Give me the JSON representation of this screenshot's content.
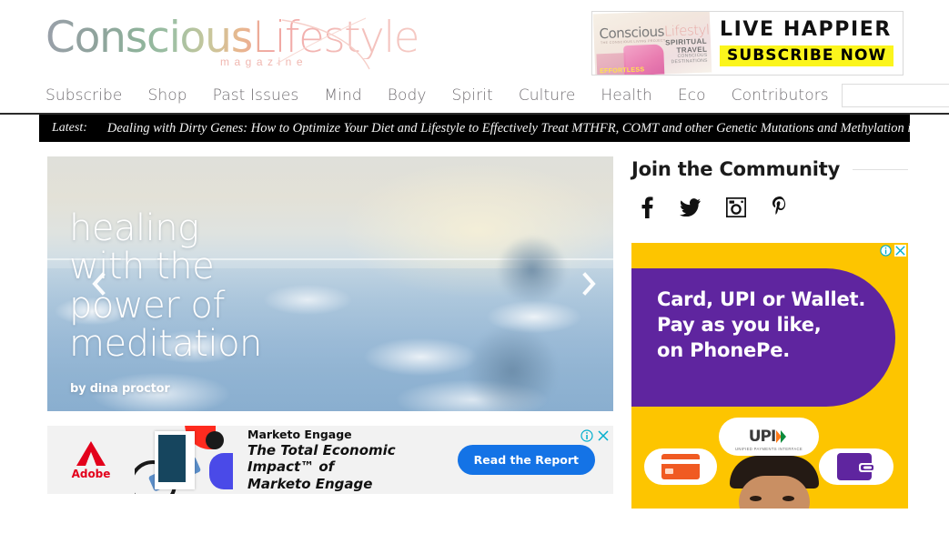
{
  "site": {
    "logo_main_1": "Conscious",
    "logo_main_2": "Lifestyle",
    "logo_sub": "magazine"
  },
  "banner_ad": {
    "cover_logo_1": "Conscious",
    "cover_logo_2": "Lifestyle",
    "cover_tagline": "THE CONSCIOUS LIVING PROJECT",
    "cover_effortless": "EFFORTLESS",
    "cover_spiritual_1": "SPIRITUAL",
    "cover_spiritual_2": "TRAVEL",
    "cover_spiritual_3": "CONSCIOUS",
    "cover_spiritual_4": "DESTINATIONS",
    "headline": "LIVE HAPPIER",
    "cta": "SUBSCRIBE NOW"
  },
  "nav": {
    "items": [
      {
        "label": "Subscribe"
      },
      {
        "label": "Shop"
      },
      {
        "label": "Past Issues"
      },
      {
        "label": "Mind"
      },
      {
        "label": "Body"
      },
      {
        "label": "Spirit"
      },
      {
        "label": "Culture"
      },
      {
        "label": "Health"
      },
      {
        "label": "Eco"
      },
      {
        "label": "Contributors"
      }
    ],
    "search": {
      "value": "",
      "placeholder": "",
      "icon": "search-icon"
    }
  },
  "ticker": {
    "label": "Latest:",
    "text": "Dealing with Dirty Genes: How to Optimize Your Diet and Lifestyle to Effectively Treat MTHFR, COMT and other Genetic Mutations and Methylation i"
  },
  "hero": {
    "title_line_1": "healing",
    "title_line_2": "with the",
    "title_line_3": "power of",
    "title_line_4": "meditation",
    "byline": "by dina proctor",
    "prev_icon": "chevron-left-icon",
    "next_icon": "chevron-right-icon"
  },
  "adobe_ad": {
    "brand": "Adobe",
    "kicker": "Marketo Engage",
    "headline_1": "The Total Economic Impact™ of",
    "headline_2": "Marketo Engage",
    "cta": "Read the Report",
    "info_icon": "ad-info-icon",
    "close_icon": "ad-close-icon",
    "control_color": "#00AECD"
  },
  "community": {
    "title": "Join the Community",
    "socials": [
      {
        "name": "facebook-icon",
        "label": "Facebook"
      },
      {
        "name": "twitter-icon",
        "label": "Twitter"
      },
      {
        "name": "instagram-icon",
        "label": "Instagram"
      },
      {
        "name": "pinterest-icon",
        "label": "Pinterest"
      }
    ]
  },
  "phonepe_ad": {
    "line_1": "Card, UPI or Wallet.",
    "line_2": "Pay as you like,",
    "line_3": "on PhonePe.",
    "upi_logo": "UPI",
    "upi_sub": "UNIFIED PAYMENTS INTERFACE",
    "card_icon": "credit-card-icon",
    "wallet_icon": "wallet-icon",
    "info_icon": "ad-info-icon",
    "close_icon": "ad-close-icon",
    "bg_color": "#FDC500",
    "brand_color": "#5F259F"
  }
}
